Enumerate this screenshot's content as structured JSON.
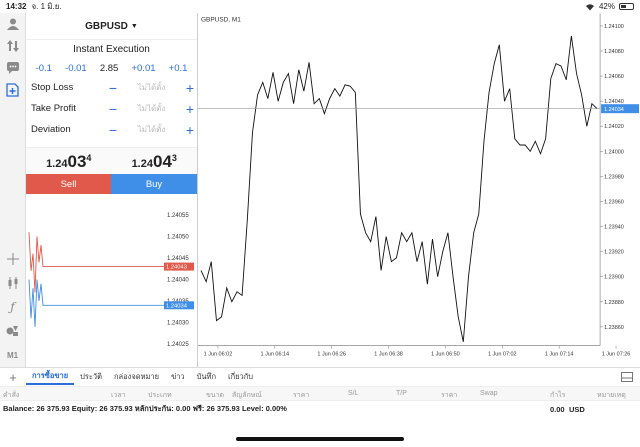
{
  "status": {
    "time": "14:32",
    "date": "จ. 1 มิ.ย.",
    "battery": "42%"
  },
  "order": {
    "symbol": "GBPUSD",
    "execution": "Instant Execution",
    "deviation_steps": [
      "-0.1",
      "-0.01",
      "2.85",
      "+0.01",
      "+0.1"
    ],
    "params": [
      {
        "label": "Stop Loss",
        "value": "ไม่ได้ตั้ง"
      },
      {
        "label": "Take Profit",
        "value": "ไม่ได้ตั้ง"
      },
      {
        "label": "Deviation",
        "value": "ไม่ได้ตั้ง"
      }
    ],
    "sell_quote": {
      "pre": "1.24",
      "big": "03",
      "sup": "4"
    },
    "buy_quote": {
      "pre": "1.24",
      "big": "04",
      "sup": "3"
    },
    "sell_label": "Sell",
    "buy_label": "Buy"
  },
  "mini_chart": {
    "ticks": [
      "1.24055",
      "1.24050",
      "1.24045",
      "1.24040",
      "1.24035",
      "1.24030",
      "1.24025"
    ],
    "ask_label": "1.24043",
    "bid_label": "1.24034",
    "ask_color": "#e0594a",
    "bid_color": "#3f8fe8"
  },
  "chart_data": {
    "type": "line",
    "title": "GBPUSD, M1",
    "x_ticks": [
      "1 Jun 06:02",
      "1 Jun 06:14",
      "1 Jun 06:26",
      "1 Jun 06:38",
      "1 Jun 06:50",
      "1 Jun 07:02",
      "1 Jun 07:14",
      "1 Jun 07:26"
    ],
    "y_ticks": [
      "1.24100",
      "1.24080",
      "1.24060",
      "1.24040",
      "1.24020",
      "1.24000",
      "1.23980",
      "1.23960",
      "1.23940",
      "1.23920",
      "1.23900",
      "1.23880",
      "1.23860"
    ],
    "ylim": [
      1.23845,
      1.2411
    ],
    "current_label": "1.24034",
    "current_value": 1.24034,
    "values": [
      1.23905,
      1.23896,
      1.23912,
      1.23865,
      1.23868,
      1.23891,
      1.2388,
      1.23888,
      1.23885,
      1.23945,
      1.24015,
      1.24045,
      1.24055,
      1.24042,
      1.24063,
      1.2404,
      1.24055,
      1.24062,
      1.24038,
      1.24065,
      1.24048,
      1.24071,
      1.24038,
      1.24042,
      1.2403,
      1.24042,
      1.2405,
      1.24044,
      1.24053,
      1.24052,
      1.24047,
      1.2395,
      1.23935,
      1.23928,
      1.23948,
      1.23905,
      1.23932,
      1.23912,
      1.23915,
      1.23935,
      1.23928,
      1.23935,
      1.23912,
      1.23928,
      1.23894,
      1.2393,
      1.239,
      1.2392,
      1.23935,
      1.239,
      1.23868,
      1.23848,
      1.239,
      1.23935,
      1.2395,
      1.24008,
      1.24047,
      1.2407,
      1.24085,
      1.2404,
      1.2405,
      1.2401,
      1.24005,
      1.24005,
      1.24,
      1.24008,
      1.23998,
      1.2401,
      1.24058,
      1.2407,
      1.24068,
      1.24057,
      1.24092,
      1.24062,
      1.24045,
      1.2402,
      1.24038,
      1.24034
    ],
    "line_color": "#111111",
    "grid": false
  },
  "tabs": {
    "items": [
      "การซื้อขาย",
      "ประวัติ",
      "กล่องจดหมาย",
      "ข่าว",
      "บันทึก",
      "เกี่ยวกับ"
    ],
    "active": 0
  },
  "table": {
    "headers": [
      "คำสั่ง",
      "เวลา",
      "ประเภท",
      "ขนาด",
      "สัญลักษณ์",
      "ราคา",
      "S/L",
      "T/P",
      "ราคา",
      "Swap",
      "กำไร",
      "หมายเหตุ"
    ]
  },
  "balance": {
    "text": "Balance: 26 375.93 Equity: 26 375.93 หลักประกัน: 0.00 ฟรี: 26 375.93 Level: 0.00%",
    "profit": "0.00",
    "currency": "USD"
  }
}
